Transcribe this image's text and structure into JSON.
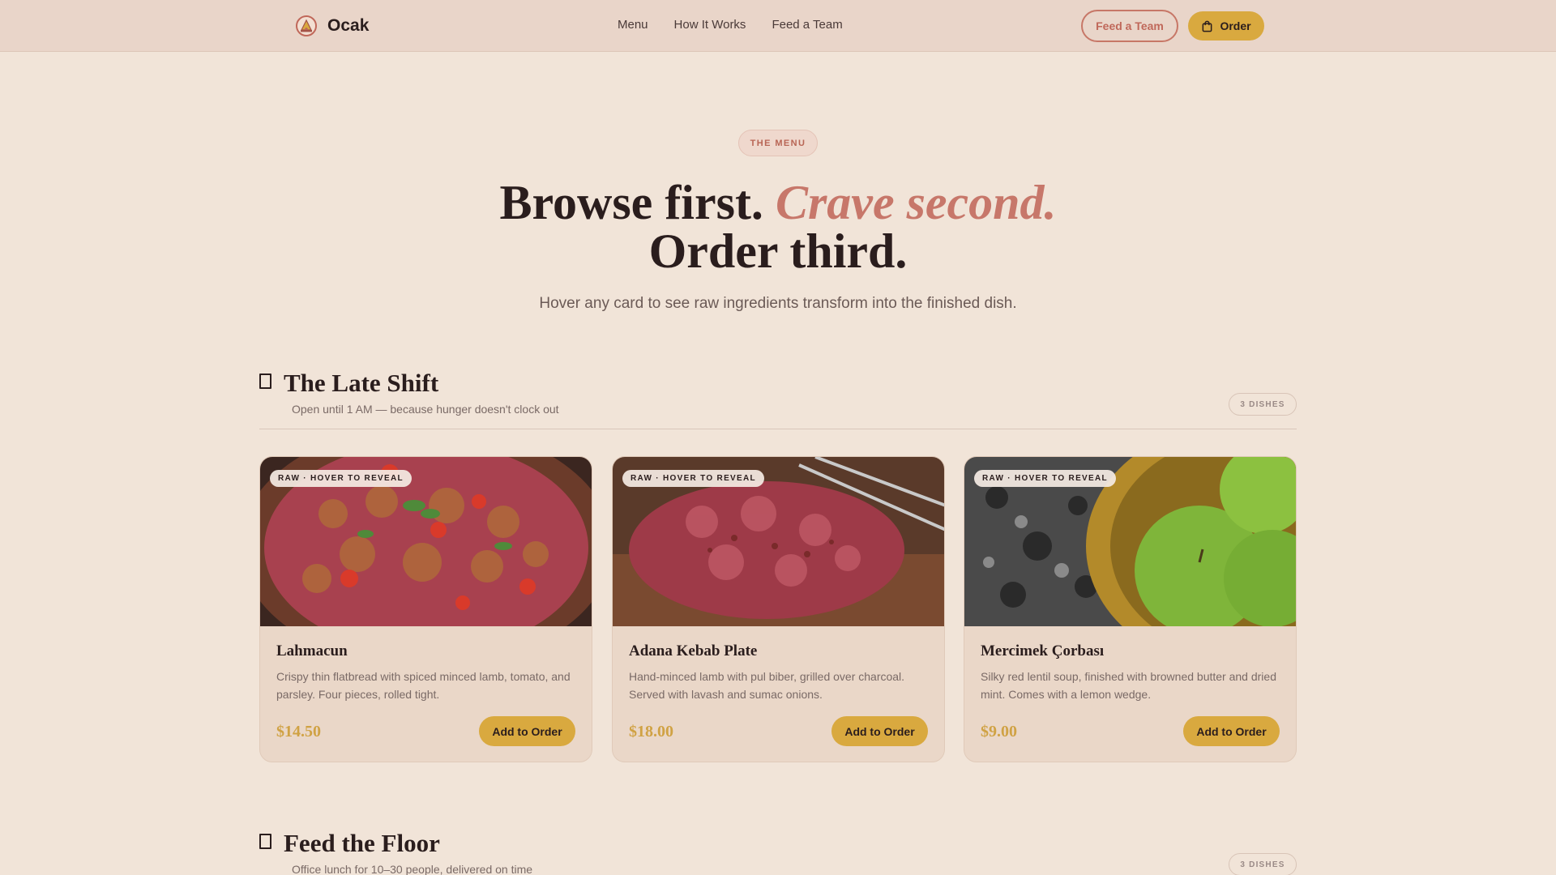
{
  "nav": {
    "brand": "Ocak",
    "links": [
      "Menu",
      "How It Works",
      "Feed a Team"
    ],
    "feed_team_button": "Feed a Team",
    "order_button": "Order"
  },
  "hero": {
    "pill": "THE MENU",
    "title_part1": "Browse first.",
    "title_accent": "Crave second.",
    "title_part2": "Order third.",
    "subtitle": "Hover any card to see raw ingredients transform into the finished dish."
  },
  "sections": [
    {
      "title": "The Late Shift",
      "subtitle": "Open until 1 AM — because hunger doesn't clock out",
      "count": "3 DISHES",
      "cards": [
        {
          "tag": "RAW · HOVER TO REVEAL",
          "name": "Lahmacun",
          "description": "Crispy thin flatbread with spiced minced lamb, tomato, and parsley. Four pieces, rolled tight.",
          "price": "$14.50",
          "button": "Add to Order"
        },
        {
          "tag": "RAW · HOVER TO REVEAL",
          "name": "Adana Kebab Plate",
          "description": "Hand-minced lamb with pul biber, grilled over charcoal. Served with lavash and sumac onions.",
          "price": "$18.00",
          "button": "Add to Order"
        },
        {
          "tag": "RAW · HOVER TO REVEAL",
          "name": "Mercimek Çorbası",
          "description": "Silky red lentil soup, finished with browned butter and dried mint. Comes with a lemon wedge.",
          "price": "$9.00",
          "button": "Add to Order"
        }
      ]
    },
    {
      "title": "Feed the Floor",
      "subtitle": "Office lunch for 10–30 people, delivered on time",
      "count": "3 DISHES"
    }
  ]
}
